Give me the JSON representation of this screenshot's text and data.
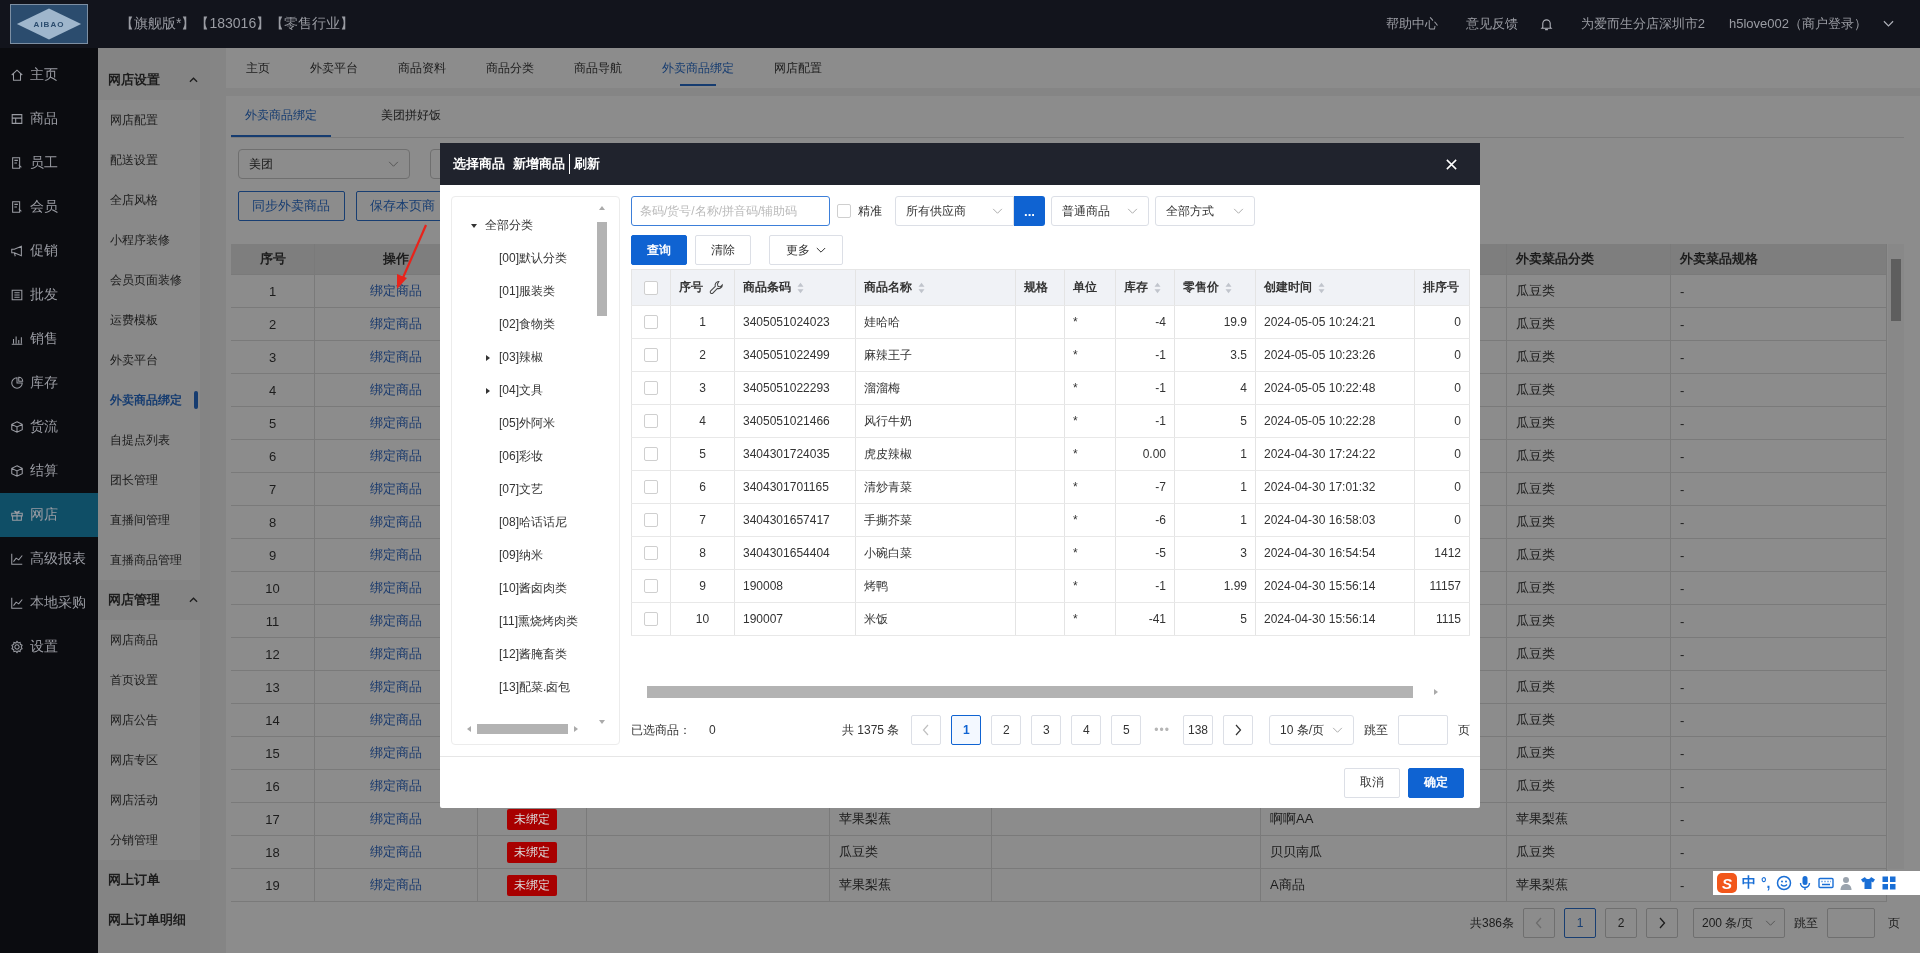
{
  "header": {
    "logo_text": "AIBAO",
    "edition": "【旗舰版*】【183016】【零售行业】",
    "links": [
      "帮助中心",
      "意见反馈"
    ],
    "store": "为爱而生分店深圳市2",
    "user": "h5love002（商户登录）"
  },
  "nav": {
    "items": [
      {
        "label": "主页",
        "selected": false
      },
      {
        "label": "商品",
        "selected": false
      },
      {
        "label": "员工",
        "selected": false
      },
      {
        "label": "会员",
        "selected": false
      },
      {
        "label": "促销",
        "selected": false
      },
      {
        "label": "批发",
        "selected": false
      },
      {
        "label": "销售",
        "selected": false
      },
      {
        "label": "库存",
        "selected": false
      },
      {
        "label": "货流",
        "selected": false
      },
      {
        "label": "结算",
        "selected": false
      },
      {
        "label": "网店",
        "selected": true
      },
      {
        "label": "高级报表",
        "selected": false
      },
      {
        "label": "本地采购",
        "selected": false
      },
      {
        "label": "设置",
        "selected": false
      }
    ]
  },
  "subnav": {
    "groups": [
      {
        "kind": "group",
        "label": "网店设置",
        "expanded": true,
        "children": [
          {
            "label": "网店配置",
            "selected": false
          },
          {
            "label": "配送设置",
            "selected": false
          },
          {
            "label": "全店风格",
            "selected": false
          },
          {
            "label": "小程序装修",
            "selected": false
          },
          {
            "label": "会员页面装修",
            "selected": false
          },
          {
            "label": "运费模板",
            "selected": false
          },
          {
            "label": "外卖平台",
            "selected": false
          },
          {
            "label": "外卖商品绑定",
            "selected": true
          },
          {
            "label": "自提点列表",
            "selected": false
          },
          {
            "label": "团长管理",
            "selected": false
          },
          {
            "label": "直播间管理",
            "selected": false
          },
          {
            "label": "直播商品管理",
            "selected": false
          }
        ]
      },
      {
        "kind": "group",
        "label": "网店管理",
        "expanded": true,
        "children": [
          {
            "label": "网店商品",
            "selected": false
          },
          {
            "label": "首页设置",
            "selected": false
          },
          {
            "label": "网店公告",
            "selected": false
          },
          {
            "label": "网店专区",
            "selected": false
          },
          {
            "label": "网店活动",
            "selected": false
          },
          {
            "label": "分销管理",
            "selected": false
          }
        ]
      },
      {
        "kind": "link",
        "label": "网上订单"
      },
      {
        "kind": "link",
        "label": "网上订单明细"
      }
    ]
  },
  "tabs": [
    {
      "label": "主页",
      "selected": false
    },
    {
      "label": "外卖平台",
      "selected": false
    },
    {
      "label": "商品资料",
      "selected": false
    },
    {
      "label": "商品分类",
      "selected": false
    },
    {
      "label": "商品导航",
      "selected": false
    },
    {
      "label": "外卖商品绑定",
      "selected": true
    },
    {
      "label": "网店配置",
      "selected": false
    }
  ],
  "subtabs": [
    {
      "label": "外卖商品绑定",
      "selected": true
    },
    {
      "label": "美团拼好饭",
      "selected": false
    }
  ],
  "filters": {
    "platform": "美团"
  },
  "actions": [
    "同步外卖商品",
    "保存本页商"
  ],
  "table": {
    "header": {
      "index": "序号",
      "action": "操作",
      "category": "外卖菜品分类",
      "spec": "外卖菜品规格"
    },
    "rows": [
      {
        "index": "1",
        "action": "绑定商品",
        "category": "瓜豆类",
        "spec": "-"
      },
      {
        "index": "2",
        "action": "绑定商品",
        "category": "瓜豆类",
        "spec": "-"
      },
      {
        "index": "3",
        "action": "绑定商品",
        "category": "瓜豆类",
        "spec": "-"
      },
      {
        "index": "4",
        "action": "绑定商品",
        "category": "瓜豆类",
        "spec": "-"
      },
      {
        "index": "5",
        "action": "绑定商品",
        "category": "瓜豆类",
        "spec": "-"
      },
      {
        "index": "6",
        "action": "绑定商品",
        "category": "瓜豆类",
        "spec": "-"
      },
      {
        "index": "7",
        "action": "绑定商品",
        "category": "瓜豆类",
        "spec": "-"
      },
      {
        "index": "8",
        "action": "绑定商品",
        "category": "瓜豆类",
        "spec": "-"
      },
      {
        "index": "9",
        "action": "绑定商品",
        "category": "瓜豆类",
        "spec": "-"
      },
      {
        "index": "10",
        "action": "绑定商品",
        "category": "瓜豆类",
        "spec": "-"
      },
      {
        "index": "11",
        "action": "绑定商品",
        "category": "瓜豆类",
        "spec": "-"
      },
      {
        "index": "12",
        "action": "绑定商品",
        "category": "瓜豆类",
        "spec": "-"
      },
      {
        "index": "13",
        "action": "绑定商品",
        "category": "瓜豆类",
        "spec": "-"
      },
      {
        "index": "14",
        "action": "绑定商品",
        "category": "瓜豆类",
        "spec": "-"
      },
      {
        "index": "15",
        "action": "绑定商品",
        "category": "瓜豆类",
        "spec": "-"
      },
      {
        "index": "16",
        "action": "绑定商品",
        "category": "瓜豆类",
        "spec": "-"
      },
      {
        "index": "17",
        "action": "绑定商品",
        "status": "未绑定",
        "column_5": "苹果梨蕉",
        "column_7": "啊啊AA",
        "category": "苹果梨蕉",
        "spec": "-"
      },
      {
        "index": "18",
        "action": "绑定商品",
        "status": "未绑定",
        "column_5": "瓜豆类",
        "column_7": "贝贝南瓜",
        "category": "瓜豆类",
        "spec": "-"
      },
      {
        "index": "19",
        "action": "绑定商品",
        "status": "未绑定",
        "column_5": "苹果梨蕉",
        "column_7": "A商品",
        "category": "苹果梨蕉",
        "spec": "-"
      }
    ],
    "pagination": {
      "total": "共386条",
      "prev_disabled": true,
      "pages": [
        {
          "label": "1",
          "selected": true
        },
        {
          "label": "2",
          "selected": false
        }
      ],
      "page_size": "200 条/页",
      "jump_label": "跳至",
      "page_suffix": "页"
    }
  },
  "modal": {
    "title": "选择商品",
    "header_links": [
      "新增商品",
      "刷新"
    ],
    "tree": [
      {
        "label": "全部分类",
        "expanded": true,
        "children": [
          {
            "label": "[00]默认分类"
          },
          {
            "label": "[01]服装类"
          },
          {
            "label": "[02]食物类"
          },
          {
            "label": "[03]辣椒",
            "expanded": false
          },
          {
            "label": "[04]文具",
            "expanded": false
          },
          {
            "label": "[05]外阿米"
          },
          {
            "label": "[06]彩妆"
          },
          {
            "label": "[07]文艺"
          },
          {
            "label": "[08]哈话话尼"
          },
          {
            "label": "[09]纳米"
          },
          {
            "label": "[10]酱卤肉类"
          },
          {
            "label": "[11]熏烧烤肉类"
          },
          {
            "label": "[12]酱腌畜类"
          },
          {
            "label": "[13]配菜.卤包"
          }
        ]
      }
    ],
    "search": {
      "placeholder": "条码/货号/名称/拼音码/辅助码",
      "focused": true
    },
    "exact": {
      "label": "精准",
      "checked": false
    },
    "supplier": "所有供应商",
    "supplier_button": "...",
    "product_type": "普通商品",
    "method": "全部方式",
    "buttons": {
      "query": "查询",
      "clear": "清除",
      "more": "更多"
    },
    "table": {
      "columns": [
        {
          "kind": "check",
          "checked": false
        },
        {
          "kind": "index",
          "label": "序号",
          "sortable": false
        },
        {
          "kind": "text",
          "label": "商品条码",
          "sortable": true
        },
        {
          "kind": "text",
          "label": "商品名称",
          "sortable": true
        },
        {
          "kind": "text",
          "label": "规格",
          "sortable": false
        },
        {
          "kind": "text",
          "label": "单位",
          "sortable": false
        },
        {
          "kind": "number",
          "label": "库存",
          "sortable": true
        },
        {
          "kind": "number",
          "label": "零售价",
          "sortable": true
        },
        {
          "kind": "text",
          "label": "创建时间",
          "sortable": true
        },
        {
          "kind": "number",
          "label": "排序号",
          "sortable": false
        }
      ],
      "rows": [
        {
          "checked": false,
          "cells": [
            "",
            "1",
            "3405051024023",
            "娃哈哈",
            "",
            "*",
            "-4",
            "19.9",
            "2024-05-05 10:24:21",
            "0"
          ]
        },
        {
          "checked": false,
          "cells": [
            "",
            "2",
            "3405051022499",
            "麻辣王子",
            "",
            "*",
            "-1",
            "3.5",
            "2024-05-05 10:23:26",
            "0"
          ]
        },
        {
          "checked": false,
          "cells": [
            "",
            "3",
            "3405051022293",
            "溜溜梅",
            "",
            "*",
            "-1",
            "4",
            "2024-05-05 10:22:48",
            "0"
          ]
        },
        {
          "checked": false,
          "cells": [
            "",
            "4",
            "3405051021466",
            "风行牛奶",
            "",
            "*",
            "-1",
            "5",
            "2024-05-05 10:22:28",
            "0"
          ]
        },
        {
          "checked": false,
          "cells": [
            "",
            "5",
            "3404301724035",
            "虎皮辣椒",
            "",
            "*",
            "0.00",
            "1",
            "2024-04-30 17:24:22",
            "0"
          ]
        },
        {
          "checked": false,
          "cells": [
            "",
            "6",
            "3404301701165",
            "清炒青菜",
            "",
            "*",
            "-7",
            "1",
            "2024-04-30 17:01:32",
            "0"
          ]
        },
        {
          "checked": false,
          "cells": [
            "",
            "7",
            "3404301657417",
            "手撕芥菜",
            "",
            "*",
            "-6",
            "1",
            "2024-04-30 16:58:03",
            "0"
          ]
        },
        {
          "checked": false,
          "cells": [
            "",
            "8",
            "3404301654404",
            "小碗白菜",
            "",
            "*",
            "-5",
            "3",
            "2024-04-30 16:54:54",
            "1412"
          ]
        },
        {
          "checked": false,
          "cells": [
            "",
            "9",
            "190008",
            "烤鸭",
            "",
            "*",
            "-1",
            "1.99",
            "2024-04-30 15:56:14",
            "11157"
          ]
        },
        {
          "checked": false,
          "cells": [
            "",
            "10",
            "190007",
            "米饭",
            "",
            "*",
            "-41",
            "5",
            "2024-04-30 15:56:14",
            "1115"
          ]
        }
      ]
    },
    "pagination": {
      "selected_label": "已选商品：",
      "selected_count": "0",
      "total": "共 1375 条",
      "prev_disabled": true,
      "pages": [
        {
          "kind": "page",
          "label": "1",
          "selected": true
        },
        {
          "kind": "page",
          "label": "2",
          "selected": false
        },
        {
          "kind": "page",
          "label": "3",
          "selected": false
        },
        {
          "kind": "page",
          "label": "4",
          "selected": false
        },
        {
          "kind": "page",
          "label": "5",
          "selected": false
        },
        {
          "kind": "ellipsis",
          "label": "•••",
          "selected": false
        },
        {
          "kind": "page",
          "label": "138",
          "selected": false
        }
      ],
      "page_size": "10 条/页",
      "jump_label": "跳至",
      "page_suffix": "页"
    },
    "footer": {
      "cancel": "取消",
      "confirm": "确定"
    }
  },
  "ime": {
    "logo": "S",
    "mode": "中",
    "punctuation": "°,"
  }
}
